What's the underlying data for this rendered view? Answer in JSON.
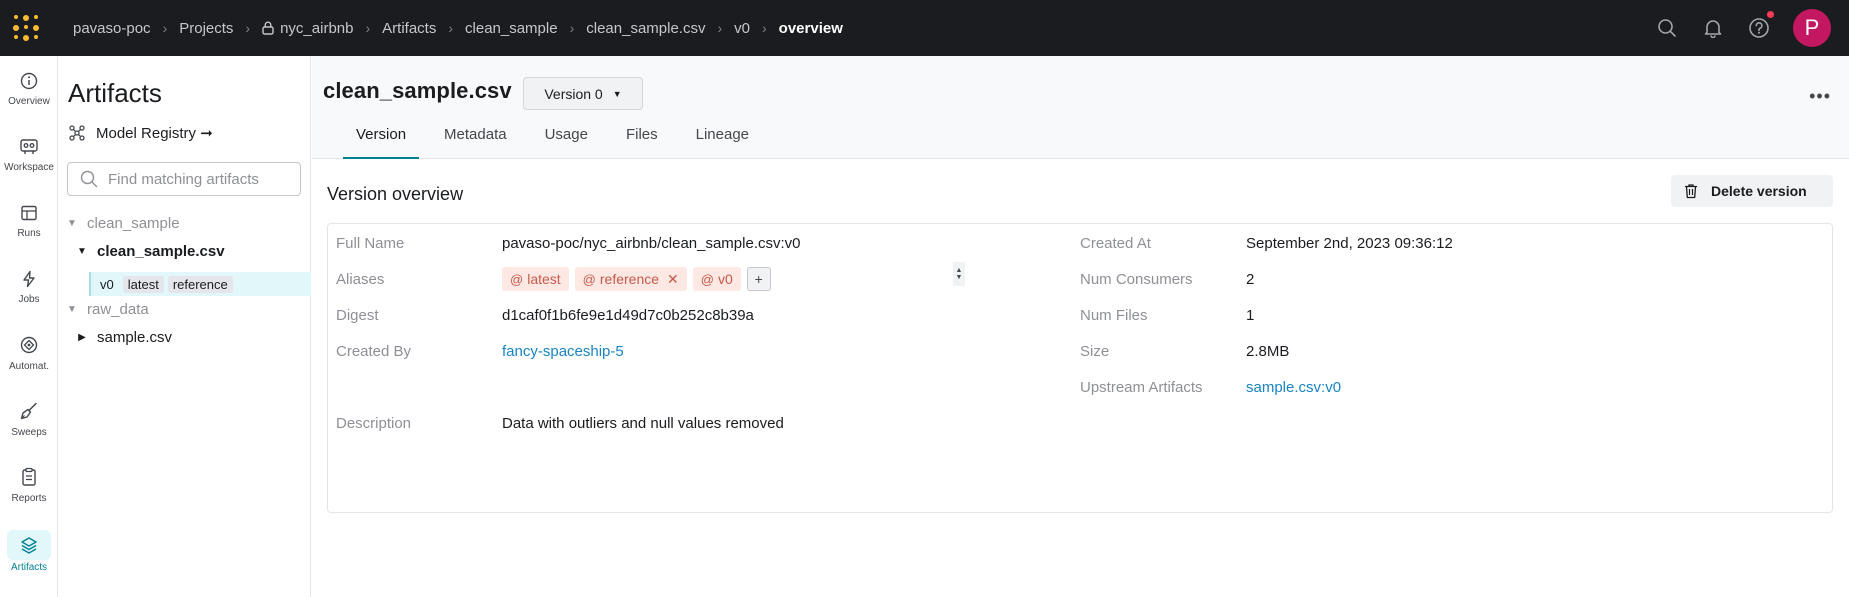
{
  "topbar": {
    "breadcrumbs": [
      {
        "label": "pavaso-poc"
      },
      {
        "label": "Projects"
      },
      {
        "label": "nyc_airbnb"
      },
      {
        "label": "Artifacts"
      },
      {
        "label": "clean_sample"
      },
      {
        "label": "clean_sample.csv"
      },
      {
        "label": "v0"
      },
      {
        "label": "overview"
      }
    ],
    "avatar_initial": "P",
    "icons": [
      "search-icon",
      "bell-icon",
      "help-icon"
    ]
  },
  "leftnav": {
    "items": [
      {
        "label": "Overview",
        "icon": "info-icon"
      },
      {
        "label": "Workspace",
        "icon": "workspace-icon"
      },
      {
        "label": "Runs",
        "icon": "table-icon"
      },
      {
        "label": "Jobs",
        "icon": "lightning-icon"
      },
      {
        "label": "Automat.",
        "icon": "automation-icon"
      },
      {
        "label": "Sweeps",
        "icon": "broom-icon"
      },
      {
        "label": "Reports",
        "icon": "clipboard-icon"
      },
      {
        "label": "Artifacts",
        "icon": "layers-icon",
        "active": true
      }
    ]
  },
  "sidebar": {
    "title": "Artifacts",
    "registry_link": "Model Registry ➞",
    "search_placeholder": "Find matching artifacts",
    "tree": {
      "group1": "clean_sample",
      "file1": "clean_sample.csv",
      "version": {
        "id": "v0",
        "aliases": [
          "latest",
          "reference"
        ]
      },
      "group2": "raw_data",
      "file2": "sample.csv"
    }
  },
  "main": {
    "artifact_title": "clean_sample.csv",
    "version_select": "Version 0",
    "tabs": [
      {
        "label": "Version",
        "active": true
      },
      {
        "label": "Metadata"
      },
      {
        "label": "Usage"
      },
      {
        "label": "Files"
      },
      {
        "label": "Lineage"
      }
    ],
    "overview_title": "Version overview",
    "delete_label": "Delete version",
    "left_fields": {
      "full_name": {
        "key": "Full Name",
        "value": "pavaso-poc/nyc_airbnb/clean_sample.csv:v0"
      },
      "aliases": {
        "key": "Aliases",
        "values": [
          "latest",
          "reference",
          "v0"
        ],
        "add_label": "+"
      },
      "digest": {
        "key": "Digest",
        "value": "d1caf0f1b6fe9e1d49d7c0b252c8b39a"
      },
      "created_by": {
        "key": "Created By",
        "value": "fancy-spaceship-5"
      },
      "description": {
        "key": "Description",
        "value": "Data with outliers and null values removed"
      }
    },
    "right_fields": {
      "created_at": {
        "key": "Created At",
        "value": "September 2nd, 2023 09:36:12"
      },
      "num_consumers": {
        "key": "Num Consumers",
        "value": "2"
      },
      "num_files": {
        "key": "Num Files",
        "value": "1"
      },
      "size": {
        "key": "Size",
        "value": "2.8MB"
      },
      "upstream": {
        "key": "Upstream Artifacts",
        "value": "sample.csv:v0"
      }
    }
  },
  "colors": {
    "topbar_bg": "#1a1c1f",
    "accent": "#038194",
    "link": "#1a84c3",
    "alias_bg": "#fde8e4",
    "alias_text": "#c75a4a",
    "avatar_bg": "#c41761"
  }
}
